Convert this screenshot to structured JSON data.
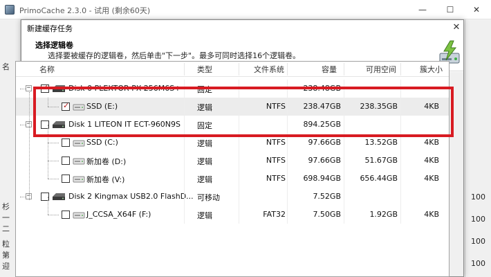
{
  "main_window": {
    "title": "PrimoCache 2.3.0 - 试用 (剩余60天)",
    "controls": {
      "minimize": "—",
      "maximize": "☐",
      "close": "✕"
    },
    "left_fragments": [
      "名",
      "杉",
      "一",
      "二",
      "粒",
      "第",
      "迎"
    ],
    "right_numbers": [
      "100",
      "100",
      "100",
      "100"
    ]
  },
  "dialog": {
    "title": "新建缓存任务",
    "close": "✕",
    "header": {
      "title": "选择逻辑卷",
      "subtitle": "选择要被缓存的逻辑卷，然后单击\"下一步\"。最多可同时选择16个逻辑卷。"
    },
    "columns": [
      "名称",
      "类型",
      "文件系统",
      "容量",
      "可用空间",
      "簇大小"
    ],
    "rows": [
      {
        "kind": "disk",
        "expander": "−",
        "checked": true,
        "name": "Disk 0 PLEXTOR PX-256M6S+",
        "type": "固定",
        "fs": "",
        "capacity": "238.48GB",
        "free": "",
        "cluster": ""
      },
      {
        "kind": "vol",
        "checked": true,
        "name": "SSD (E:)",
        "type": "逻辑",
        "fs": "NTFS",
        "capacity": "238.47GB",
        "free": "238.35GB",
        "cluster": "4KB",
        "selected": true
      },
      {
        "kind": "disk",
        "expander": "−",
        "checked": false,
        "name": "Disk 1 LITEON IT ECT-960N9S",
        "type": "固定",
        "fs": "",
        "capacity": "894.25GB",
        "free": "",
        "cluster": ""
      },
      {
        "kind": "vol",
        "checked": false,
        "name": "SSD (C:)",
        "type": "逻辑",
        "fs": "NTFS",
        "capacity": "97.66GB",
        "free": "13.52GB",
        "cluster": "4KB"
      },
      {
        "kind": "vol",
        "checked": false,
        "name": "新加卷 (D:)",
        "type": "逻辑",
        "fs": "NTFS",
        "capacity": "97.66GB",
        "free": "51.67GB",
        "cluster": "4KB"
      },
      {
        "kind": "vol",
        "checked": false,
        "name": "新加卷 (V:)",
        "type": "逻辑",
        "fs": "NTFS",
        "capacity": "698.94GB",
        "free": "656.44GB",
        "cluster": "4KB"
      },
      {
        "kind": "disk",
        "expander": "−",
        "checked": false,
        "name": "Disk 2 Kingmax USB2.0 FlashD...",
        "type": "可移动",
        "fs": "",
        "capacity": "7.52GB",
        "free": "",
        "cluster": ""
      },
      {
        "kind": "vol",
        "checked": false,
        "name": "J_CCSA_X64F (F:)",
        "type": "逻辑",
        "fs": "FAT32",
        "capacity": "7.50GB",
        "free": "1.92GB",
        "cluster": "4KB"
      }
    ]
  },
  "colors": {
    "highlight": "#d81b22",
    "check_mark": "#b01818",
    "selected_row": "#ececec"
  },
  "icons": {
    "app": "primocache-app-icon",
    "wizard": "drive-lightning-icon",
    "disk": "hard-disk-icon",
    "volume": "volume-icon"
  }
}
